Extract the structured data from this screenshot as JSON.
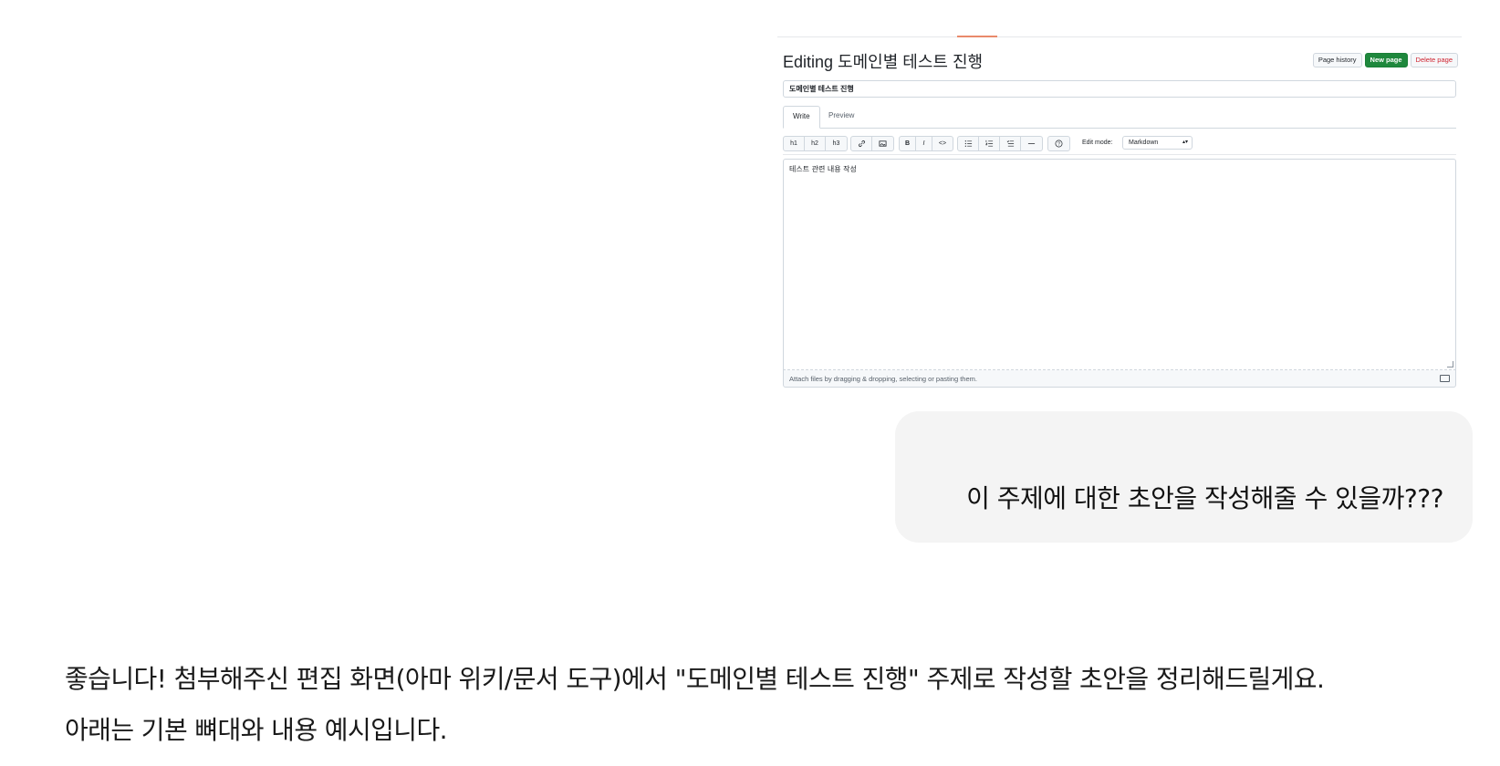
{
  "attachment": {
    "title": "Editing 도메인별 테스트 진행",
    "header_buttons": {
      "page_history": "Page history",
      "new_page": "New page",
      "delete_page": "Delete page"
    },
    "page_name_value": "도메인별 테스트 진행",
    "tabs": {
      "write": "Write",
      "preview": "Preview"
    },
    "toolbar": {
      "headings": [
        "h1",
        "h2",
        "h3"
      ],
      "bold": "B",
      "italic": "I",
      "code": "<>",
      "help": "?",
      "edit_mode_label": "Edit mode:",
      "edit_mode_value": "Markdown"
    },
    "editor_content": "테스트 관련 내용 작성",
    "attach_hint": "Attach files by dragging & dropping, selecting or pasting them."
  },
  "user_message": "이 주제에 대한 초안을 작성해줄 수 있을까???",
  "assistant_message": {
    "line1": "좋습니다! 첨부해주신 편집 화면(아마 위키/문서 도구)에서 \"도메인별 테스트 진행\" 주제로 작성할 초안을 정리해드릴게요.",
    "line2": "아래는 기본 뼈대와 내용 예시입니다."
  },
  "colors": {
    "primary_green": "#1f883d",
    "danger_red": "#cf222e",
    "bubble_bg": "#f4f4f4"
  }
}
